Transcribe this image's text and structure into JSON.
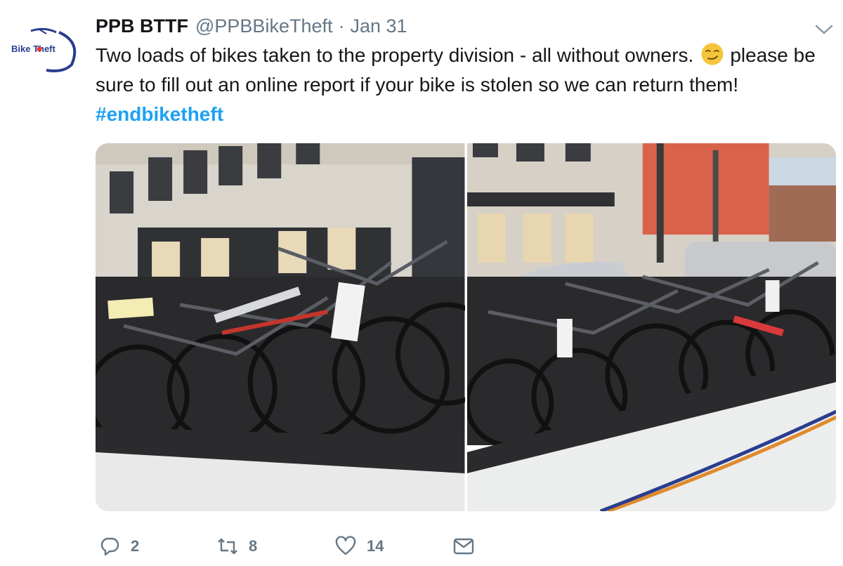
{
  "tweet": {
    "display_name": "PPB BTTF",
    "handle": "@PPBBikeTheft",
    "separator": "·",
    "date": "Jan 31",
    "text_part1": "Two loads of bikes taken to the property division - all without owners.",
    "text_part2": "please be sure to fill out an online report if your bike is stolen so we can return them!",
    "hashtag": "#endbiketheft",
    "avatar_text": "Bike Theft",
    "emoji": "smirking-face-emoji"
  },
  "actions": {
    "reply_count": "2",
    "retweet_count": "8",
    "like_count": "14"
  },
  "icons": [
    "chevron-down-icon",
    "reply-icon",
    "retweet-icon",
    "heart-icon",
    "dm-envelope-icon"
  ],
  "colors": {
    "link": "#1da1f2",
    "muted": "#657786",
    "text": "#14171a"
  }
}
